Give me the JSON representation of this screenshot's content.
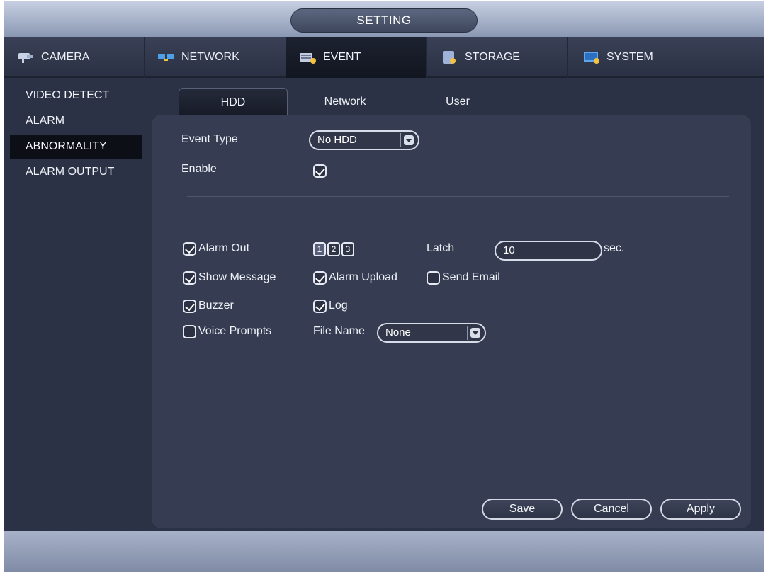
{
  "window": {
    "title": "SETTING"
  },
  "topnav": [
    {
      "label": "CAMERA",
      "icon": "camera-icon"
    },
    {
      "label": "NETWORK",
      "icon": "network-icon"
    },
    {
      "label": "EVENT",
      "icon": "event-icon"
    },
    {
      "label": "STORAGE",
      "icon": "storage-icon"
    },
    {
      "label": "SYSTEM",
      "icon": "system-icon"
    }
  ],
  "topnav_active": "EVENT",
  "sidebar": [
    {
      "label": "VIDEO DETECT"
    },
    {
      "label": "ALARM"
    },
    {
      "label": "ABNORMALITY"
    },
    {
      "label": "ALARM OUTPUT"
    }
  ],
  "sidebar_active": "ABNORMALITY",
  "subtabs": [
    {
      "label": "HDD"
    },
    {
      "label": "Network"
    },
    {
      "label": "User"
    }
  ],
  "subtab_active": "HDD",
  "form": {
    "event_type_label": "Event Type",
    "event_type_value": "No HDD",
    "enable_label": "Enable",
    "enable_checked": true,
    "alarm_out_label": "Alarm Out",
    "alarm_out_checked": true,
    "alarm_channels": [
      "1",
      "2",
      "3"
    ],
    "alarm_channels_selected": [
      "1"
    ],
    "latch_label": "Latch",
    "latch_value": "10",
    "latch_unit": "sec.",
    "show_message_label": "Show Message",
    "show_message_checked": true,
    "alarm_upload_label": "Alarm Upload",
    "alarm_upload_checked": true,
    "send_email_label": "Send Email",
    "send_email_checked": false,
    "buzzer_label": "Buzzer",
    "buzzer_checked": true,
    "log_label": "Log",
    "log_checked": true,
    "voice_prompts_label": "Voice Prompts",
    "voice_prompts_checked": false,
    "file_name_label": "File Name",
    "file_name_value": "None"
  },
  "buttons": {
    "save": "Save",
    "cancel": "Cancel",
    "apply": "Apply"
  },
  "colors": {
    "background": "#2c3245",
    "panel": "#363d53",
    "titlebar": "#a5b1c8",
    "selected_row": "#0d0f16"
  }
}
